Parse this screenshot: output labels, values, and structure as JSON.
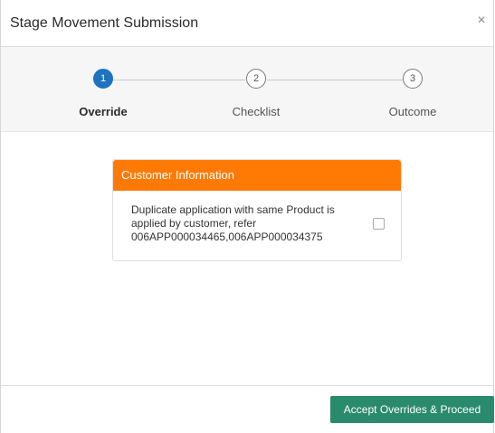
{
  "dialog": {
    "title": "Stage Movement Submission",
    "close_glyph": "×"
  },
  "stepper": {
    "steps": [
      {
        "number": "1",
        "label": "Override",
        "active": true
      },
      {
        "number": "2",
        "label": "Checklist",
        "active": false
      },
      {
        "number": "3",
        "label": "Outcome",
        "active": false
      }
    ]
  },
  "card": {
    "header": "Customer Information",
    "message_line1": "Duplicate application with same Product is",
    "message_line2": "applied by customer, refer",
    "message_line3": "006APP000034465,006APP000034375",
    "checked": false
  },
  "footer": {
    "primary_button": "Accept Overrides & Proceed"
  },
  "colors": {
    "active_step": "#1e73be",
    "card_header": "#ff7a05",
    "primary_button": "#2a8a6c"
  },
  "icons": {
    "close": "close-icon",
    "checkbox": "checkbox-icon"
  }
}
